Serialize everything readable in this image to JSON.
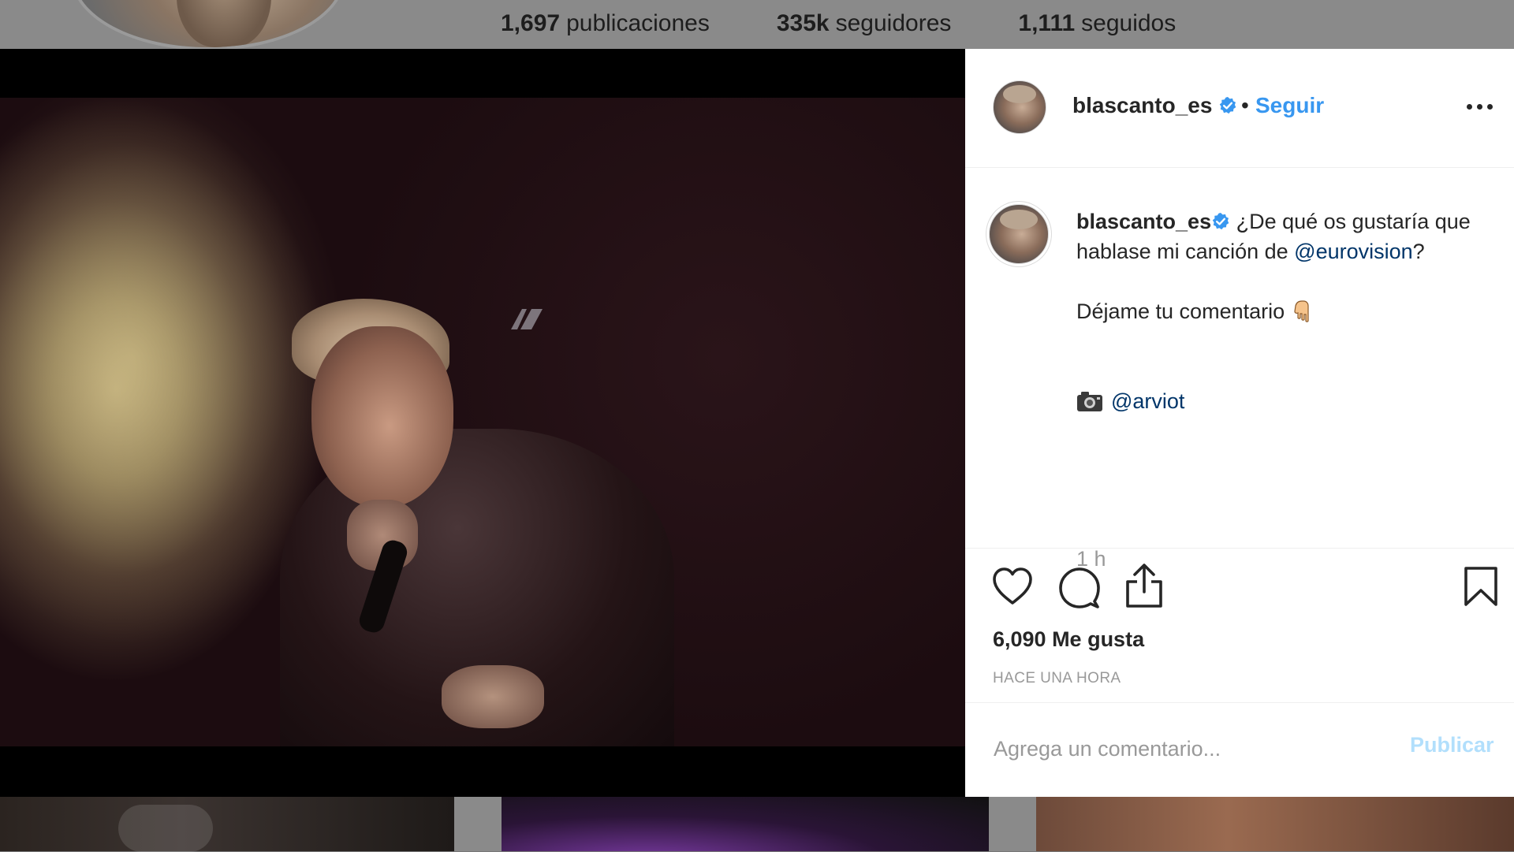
{
  "profile": {
    "stats": [
      {
        "value": "1,697",
        "label": "publicaciones"
      },
      {
        "value": "335k",
        "label": "seguidores"
      },
      {
        "value": "1,111",
        "label": "seguidos"
      }
    ]
  },
  "post": {
    "username": "blascanto_es",
    "separator": "•",
    "follow_label": "Seguir",
    "caption": {
      "username": "blascanto_es",
      "line1": " ¿De qué os gustaría que hablase mi canción de ",
      "mention1": "@eurovision",
      "line1_end": "?",
      "line2": "Déjame tu comentario ",
      "mention2": "@arviot",
      "relative_time": "1 h"
    },
    "likes": "6,090 Me gusta",
    "timestamp": "HACE UNA HORA",
    "comment_placeholder": "Agrega un comentario...",
    "publish_label": "Publicar",
    "colors": {
      "accent": "#3897f0",
      "mention": "#003569",
      "verified": "#3897f0",
      "muted": "#999999",
      "publish_disabled": "#b2dffc"
    },
    "icons": [
      "verified-badge-icon",
      "more-options-icon",
      "heart-icon",
      "comment-icon",
      "share-icon",
      "bookmark-icon",
      "pointing-down-hand-emoji",
      "camera-emoji"
    ]
  }
}
